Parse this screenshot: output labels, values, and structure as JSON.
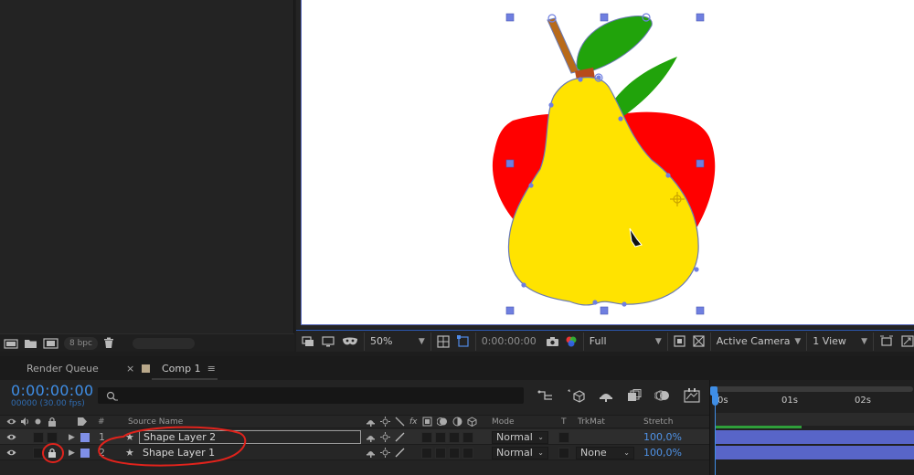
{
  "project_panel": {
    "bit_depth": "8 bpc",
    "icons": [
      "interpret-footage-icon",
      "folder-icon",
      "composition-icon",
      "trash-icon"
    ]
  },
  "viewer": {
    "zoom": "50%",
    "timecode": "0:00:00:00",
    "resolution": "Full",
    "camera": "Active Camera",
    "views": "1 View",
    "accent_color": "#2c5ab8"
  },
  "timeline_tabs": {
    "render_queue": "Render Queue",
    "comp_close": "×",
    "comp_name": "Comp 1",
    "comp_menu": "≡"
  },
  "timeline": {
    "timecode": "0:00:00:00",
    "timecode_sub": "00000 (30.00 fps)",
    "columns": {
      "num": "#",
      "source_name": "Source Name",
      "mode": "Mode",
      "t": "T",
      "trkmat": "TrkMat",
      "stretch": "Stretch"
    },
    "layers": [
      {
        "index": "1",
        "name": "Shape Layer 2",
        "mode": "Normal",
        "trkmat": "",
        "stretch": "100,0%",
        "locked": false,
        "selected": true
      },
      {
        "index": "2",
        "name": "Shape Layer 1",
        "mode": "Normal",
        "trkmat": "None",
        "stretch": "100,0%",
        "locked": true,
        "selected": false
      }
    ],
    "ruler": {
      "t0": "0s",
      "t1": "01s",
      "t2": "02s"
    },
    "layer_bar_color": "#5865c8"
  },
  "annotations": {
    "color": "#e0231c"
  }
}
